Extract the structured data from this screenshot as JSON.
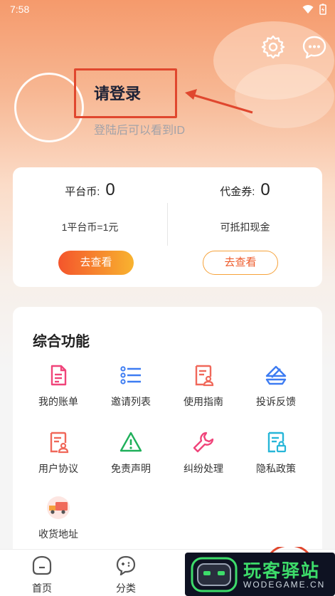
{
  "status_bar": {
    "time": "7:58"
  },
  "header": {
    "login_title": "请登录",
    "login_subtitle": "登陆后可以看到ID",
    "settings_icon": "gear-icon",
    "message_icon": "chat-bubble-icon"
  },
  "wallet": {
    "platform_coin_label": "平台币:",
    "platform_coin_value": "0",
    "platform_coin_desc": "1平台币=1元",
    "platform_coin_button": "去查看",
    "voucher_label": "代金券:",
    "voucher_value": "0",
    "voucher_desc": "可抵扣现金",
    "voucher_button": "去查看"
  },
  "functions": {
    "title": "综合功能",
    "items": [
      {
        "label": "我的账单",
        "icon": "bill-icon",
        "color": "#f0447a"
      },
      {
        "label": "邀请列表",
        "icon": "list-icon",
        "color": "#3d7cf2"
      },
      {
        "label": "使用指南",
        "icon": "guide-icon",
        "color": "#f0685a"
      },
      {
        "label": "投诉反馈",
        "icon": "feedback-icon",
        "color": "#3d7cf2"
      },
      {
        "label": "用户协议",
        "icon": "agreement-icon",
        "color": "#f0685a"
      },
      {
        "label": "免责声明",
        "icon": "warning-icon",
        "color": "#1fb05a"
      },
      {
        "label": "纠纷处理",
        "icon": "wrench-icon",
        "color": "#f0447a"
      },
      {
        "label": "隐私政策",
        "icon": "privacy-icon",
        "color": "#27b6d8"
      },
      {
        "label": "收货地址",
        "icon": "delivery-truck-icon",
        "color": "#f06a5a"
      }
    ]
  },
  "bottom_nav": {
    "items": [
      {
        "label": "首页",
        "icon": "home-icon"
      },
      {
        "label": "分类",
        "icon": "category-icon"
      }
    ]
  },
  "watermark": {
    "title": "玩客驿站",
    "subtitle": "WODEGAME.CN"
  },
  "colors": {
    "accent_orange": "#f4552c",
    "highlight_red": "#e0472e"
  }
}
